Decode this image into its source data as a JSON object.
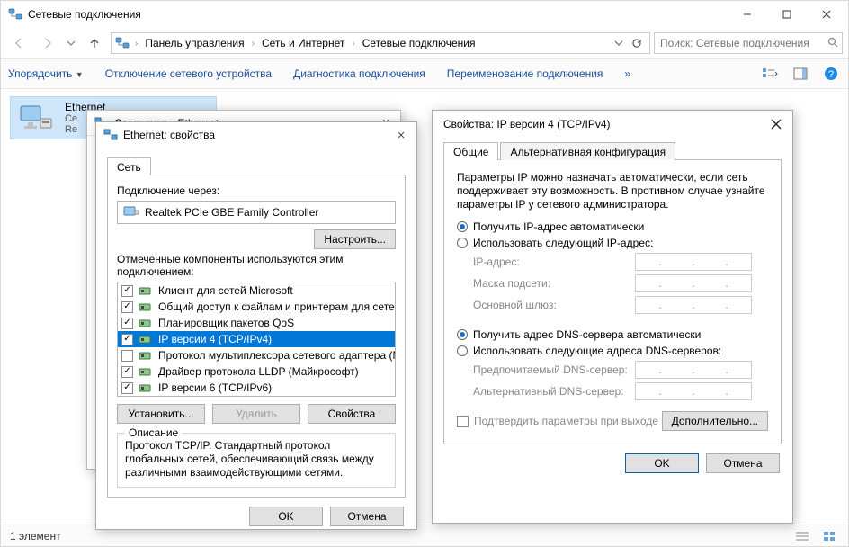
{
  "main": {
    "title": "Сетевые подключения",
    "breadcrumb": {
      "root_icon": "net-icon",
      "items": [
        "Панель управления",
        "Сеть и Интернет",
        "Сетевые подключения"
      ]
    },
    "search_placeholder": "Поиск: Сетевые подключения",
    "cmdbar": {
      "organize": "Упорядочить",
      "disable": "Отключение сетевого устройства",
      "diag": "Диагностика подключения",
      "rename": "Переименование подключения"
    },
    "item": {
      "name": "Ethernet",
      "line2": "Се",
      "line3": "Re"
    },
    "status": {
      "count": "1 элемент"
    }
  },
  "status_dialog": {
    "title": "Состояние - Ethernet"
  },
  "props_dialog": {
    "title": "Ethernet: свойства",
    "tab_net": "Сеть",
    "connect_via": "Подключение через:",
    "adapter": "Realtek PCIe GBE Family Controller",
    "configure_btn": "Настроить...",
    "components_label": "Отмеченные компоненты используются этим подключением:",
    "components": [
      {
        "checked": true,
        "label": "Клиент для сетей Microsoft"
      },
      {
        "checked": true,
        "label": "Общий доступ к файлам и принтерам для сетей Mi"
      },
      {
        "checked": true,
        "label": "Планировщик пакетов QoS"
      },
      {
        "checked": true,
        "label": "IP версии 4 (TCP/IPv4)",
        "selected": true
      },
      {
        "checked": false,
        "label": "Протокол мультиплексора сетевого адаптера (Ма"
      },
      {
        "checked": true,
        "label": "Драйвер протокола LLDP (Майкрософт)"
      },
      {
        "checked": true,
        "label": "IP версии 6 (TCP/IPv6)"
      }
    ],
    "install_btn": "Установить...",
    "uninstall_btn": "Удалить",
    "properties_btn": "Свойства",
    "desc_legend": "Описание",
    "desc_text": "Протокол TCP/IP. Стандартный протокол глобальных сетей, обеспечивающий связь между различными взаимодействующими сетями.",
    "ok": "OK",
    "cancel": "Отмена"
  },
  "ipv4_dialog": {
    "title": "Свойства: IP версии 4 (TCP/IPv4)",
    "tab_general": "Общие",
    "tab_alt": "Альтернативная конфигурация",
    "para": "Параметры IP можно назначать автоматически, если сеть поддерживает эту возможность. В противном случае узнайте параметры IP у сетевого администратора.",
    "r_auto_ip": "Получить IP-адрес автоматически",
    "r_manual_ip": "Использовать следующий IP-адрес:",
    "lab_ip": "IP-адрес:",
    "lab_mask": "Маска подсети:",
    "lab_gw": "Основной шлюз:",
    "r_auto_dns": "Получить адрес DNS-сервера автоматически",
    "r_manual_dns": "Использовать следующие адреса DNS-серверов:",
    "lab_dns1": "Предпочитаемый DNS-сервер:",
    "lab_dns2": "Альтернативный DNS-сервер:",
    "confirm_exit": "Подтвердить параметры при выходе",
    "advanced": "Дополнительно...",
    "ok": "OK",
    "cancel": "Отмена"
  }
}
